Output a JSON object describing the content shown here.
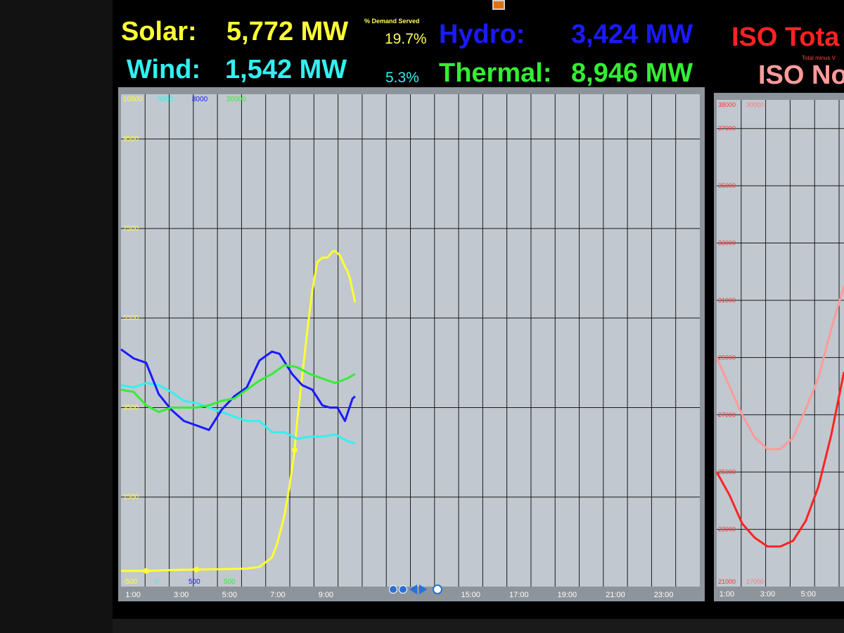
{
  "header": {
    "solar_label": "Solar:",
    "solar_value": "5,772 MW",
    "demand_served_label": "% Demand Served",
    "solar_pct": "19.7%",
    "wind_label": "Wind:",
    "wind_value": "1,542 MW",
    "wind_pct": "5.3%",
    "hydro_label": "Hydro:",
    "hydro_value": "3,424 MW",
    "thermal_label": "Thermal:",
    "thermal_value": "8,946 MW",
    "iso_total": "ISO Tota",
    "iso_total_sub": "Total minus V",
    "iso_net": "ISO No"
  },
  "colors": {
    "solar": "#ffff33",
    "wind": "#33f0f0",
    "hydro": "#1a1aff",
    "thermal": "#33ee33",
    "iso_total": "#ff2222",
    "iso_net": "#ff9a9a",
    "panel_bg": "#c1c8cf"
  },
  "chart_data": [
    {
      "type": "line",
      "xlim": [
        0,
        23
      ],
      "ylim": [
        -500,
        10500
      ],
      "x_ticks": [
        "1:00",
        "3:00",
        "5:00",
        "7:00",
        "9:00",
        "15:00",
        "17:00",
        "19:00",
        "21:00",
        "23:00"
      ],
      "y_ticks": [
        "10500",
        "9500",
        "7500",
        "5500",
        "3500",
        "1500",
        "-500"
      ],
      "series_axis_tops": [
        "5000",
        "8000",
        "20000"
      ],
      "series_axis_bottoms": [
        "0",
        "500",
        "500"
      ],
      "series": [
        {
          "key": "solar",
          "x": [
            0,
            1,
            2,
            3,
            4,
            5,
            5.5,
            6.0,
            6.2,
            6.5,
            6.7,
            6.9,
            7.0,
            7.2,
            7.4,
            7.6,
            7.8,
            8.0,
            8.2,
            8.4,
            8.5,
            8.7,
            8.9,
            9.0,
            9.1,
            9.3
          ],
          "y": [
            -150,
            -150,
            -130,
            -120,
            -110,
            -100,
            -60,
            150,
            450,
            1100,
            1750,
            2550,
            3200,
            4200,
            5200,
            6100,
            6750,
            6850,
            6850,
            6980,
            7000,
            6900,
            6650,
            6550,
            6380,
            5850
          ]
        },
        {
          "key": "wind",
          "x": [
            0,
            0.5,
            1,
            1.5,
            2,
            2.5,
            3,
            3.5,
            4,
            4.5,
            5,
            5.5,
            6,
            6.5,
            7,
            7.5,
            8,
            8.5,
            9,
            9.3
          ],
          "y": [
            4000,
            3950,
            4050,
            4000,
            3850,
            3650,
            3600,
            3500,
            3400,
            3300,
            3200,
            3200,
            2950,
            2950,
            2800,
            2850,
            2850,
            2900,
            2750,
            2700
          ]
        },
        {
          "key": "hydro",
          "x": [
            0,
            0.5,
            1,
            1.5,
            2,
            2.5,
            3,
            3.5,
            4,
            4.5,
            5,
            5.5,
            6,
            6.3,
            6.8,
            7.2,
            7.6,
            8,
            8.3,
            8.6,
            8.9,
            9.2,
            9.3
          ],
          "y": [
            4800,
            4600,
            4500,
            3800,
            3450,
            3200,
            3100,
            3000,
            3450,
            3750,
            3950,
            4550,
            4750,
            4700,
            4250,
            4000,
            3900,
            3550,
            3500,
            3500,
            3200,
            3700,
            3750
          ]
        },
        {
          "key": "thermal",
          "x": [
            0,
            0.5,
            1,
            1.5,
            2,
            2.5,
            3,
            3.5,
            4,
            4.5,
            5,
            5.5,
            6,
            6.5,
            7,
            7.5,
            8,
            8.5,
            9,
            9.3
          ],
          "y": [
            3900,
            3850,
            3550,
            3400,
            3500,
            3500,
            3500,
            3550,
            3650,
            3700,
            3900,
            4100,
            4250,
            4450,
            4400,
            4250,
            4150,
            4050,
            4150,
            4250
          ]
        }
      ]
    },
    {
      "type": "line",
      "xlim": [
        0,
        5
      ],
      "ylim": [
        21000,
        38000
      ],
      "x_ticks": [
        "1:00",
        "3:00",
        "5:00"
      ],
      "y_ticks": [
        "38000",
        "37000",
        "35000",
        "33000",
        "31000",
        "29000",
        "27000",
        "25000",
        "23000",
        "21000"
      ],
      "y_ticks_secondary": [
        "30000",
        "17000"
      ],
      "series": [
        {
          "key": "iso_total",
          "x": [
            0,
            0.5,
            1,
            1.5,
            2,
            2.5,
            3,
            3.5,
            4,
            4.5,
            5
          ],
          "y": [
            25000,
            24200,
            23200,
            22700,
            22400,
            22400,
            22600,
            23300,
            24500,
            26300,
            28500
          ]
        },
        {
          "key": "iso_net",
          "x": [
            0,
            0.5,
            1,
            1.5,
            2,
            2.5,
            3,
            3.5,
            4,
            4.5,
            5
          ],
          "y": [
            29000,
            28000,
            27000,
            26200,
            25800,
            25800,
            26200,
            27200,
            28300,
            30000,
            31500
          ]
        }
      ]
    }
  ]
}
